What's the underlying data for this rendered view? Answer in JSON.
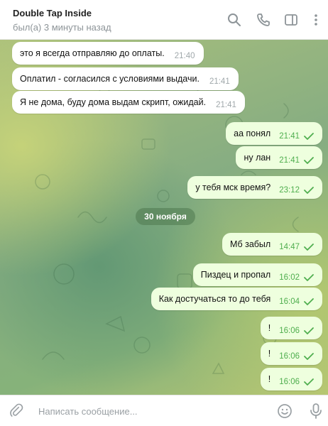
{
  "header": {
    "title": "Double Tap Inside",
    "status": "был(а) 3 минуты назад",
    "icons": [
      "search-icon",
      "phone-icon",
      "sidebar-toggle-icon",
      "more-vertical-icon"
    ]
  },
  "messages": [
    {
      "text": "это я всегда отправляю до оплаты.",
      "time": "21:40",
      "direction": "in"
    },
    {
      "text": "Оплатил - согласился с условиями выдачи.",
      "time": "21:41",
      "direction": "in"
    },
    {
      "text": "Я не дома, буду дома выдам скрипт, ожидай.",
      "time": "21:41",
      "direction": "in"
    },
    {
      "text": "аа понял",
      "time": "21:41",
      "direction": "out"
    },
    {
      "text": "ну лан",
      "time": "21:41",
      "direction": "out"
    },
    {
      "text": "у тебя мск время?",
      "time": "23:12",
      "direction": "out"
    },
    {
      "text": "Мб забыл",
      "time": "14:47",
      "direction": "out"
    },
    {
      "text": "Пиздец и пропал",
      "time": "16:02",
      "direction": "out"
    },
    {
      "text": "Как достучаться то до тебя",
      "time": "16:04",
      "direction": "out"
    },
    {
      "text": "!",
      "time": "16:06",
      "direction": "out"
    },
    {
      "text": "!",
      "time": "16:06",
      "direction": "out"
    },
    {
      "text": "!",
      "time": "16:06",
      "direction": "out"
    }
  ],
  "date_separator": "30 ноября",
  "composer": {
    "placeholder": "Написать сообщение..."
  },
  "colors": {
    "incoming_bubble": "#ffffff",
    "outgoing_bubble": "#eeffde",
    "outgoing_time": "#4fae4e",
    "check": "#4fae4e"
  }
}
